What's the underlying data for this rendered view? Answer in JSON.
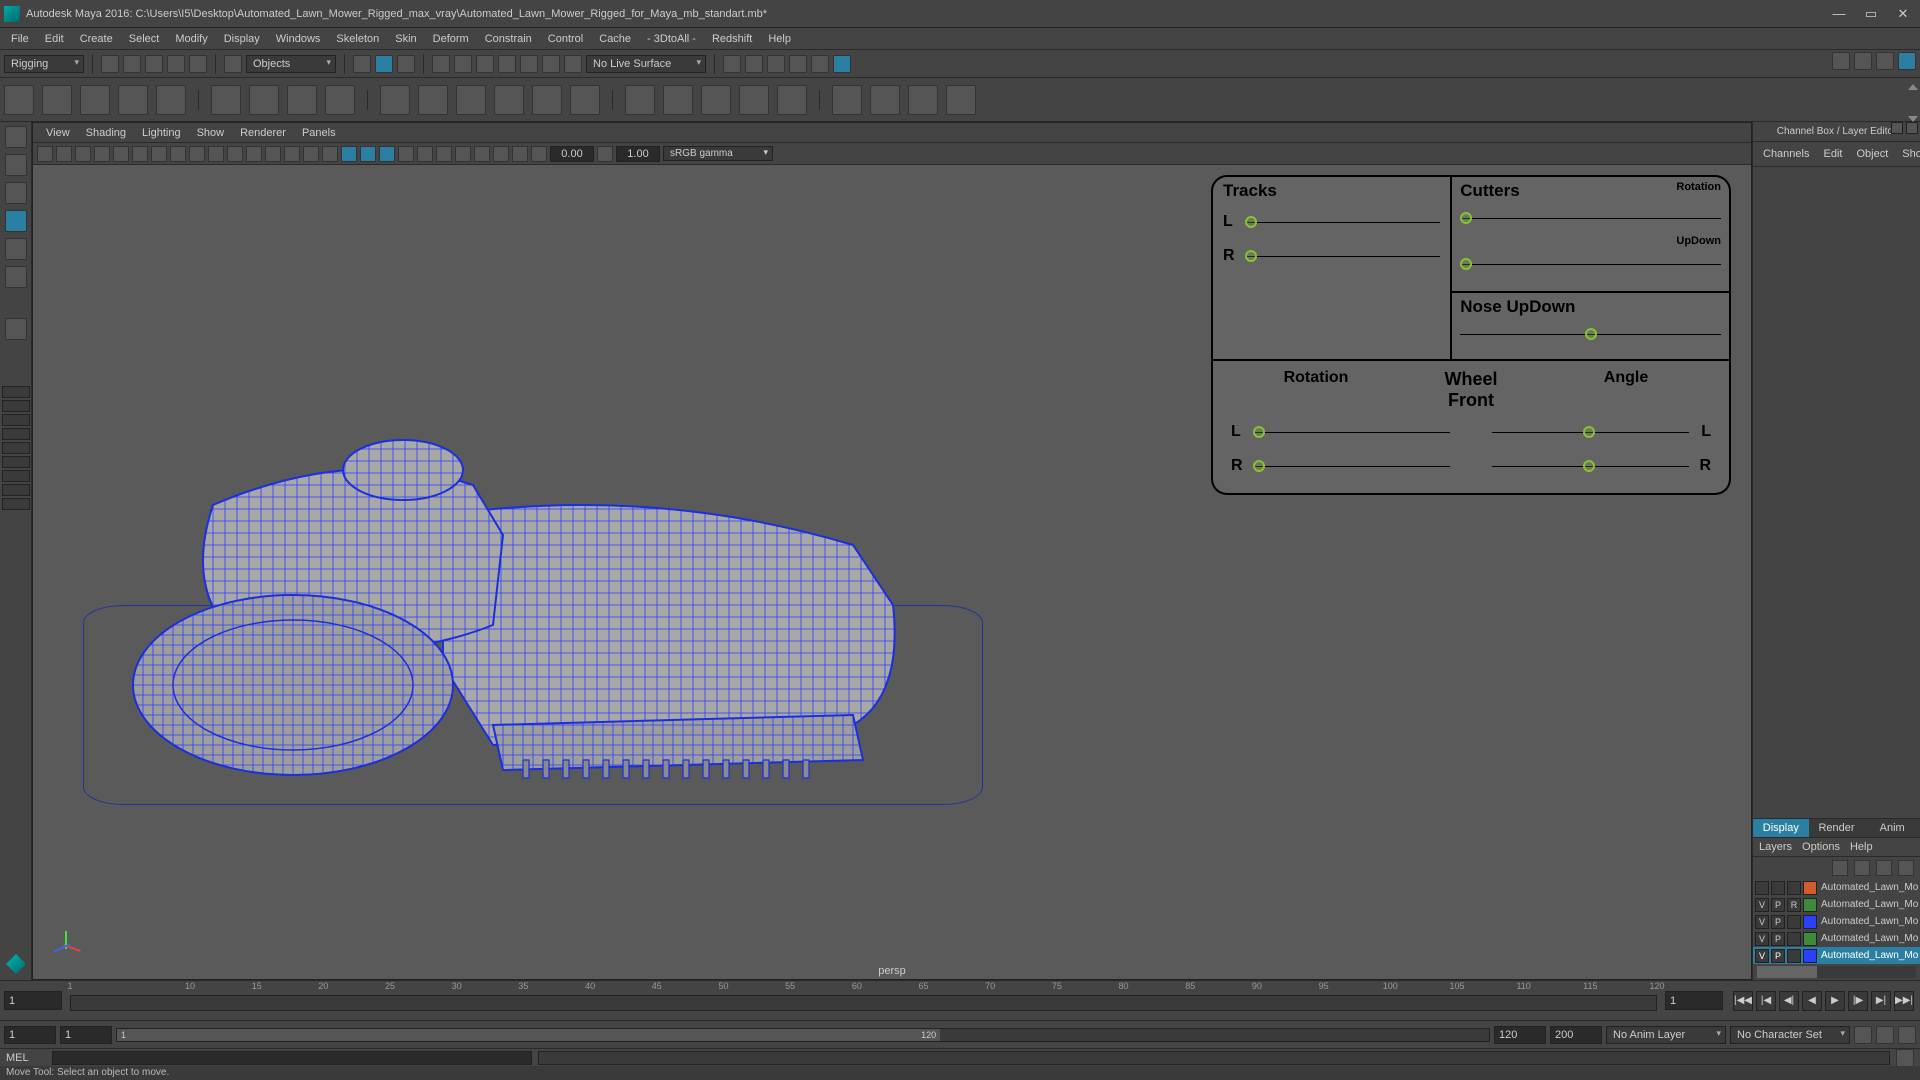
{
  "title": "Autodesk Maya 2016: C:\\Users\\I5\\Desktop\\Automated_Lawn_Mower_Rigged_max_vray\\Automated_Lawn_Mower_Rigged_for_Maya_mb_standart.mb*",
  "menubar": [
    "File",
    "Edit",
    "Create",
    "Select",
    "Modify",
    "Display",
    "Windows",
    "Skeleton",
    "Skin",
    "Deform",
    "Constrain",
    "Control",
    "Cache",
    "- 3DtoAll -",
    "Redshift",
    "Help"
  ],
  "shelf": {
    "mode": "Rigging",
    "mask_label": "Objects",
    "surface_label": "No Live Surface"
  },
  "viewport": {
    "menus": [
      "View",
      "Shading",
      "Lighting",
      "Show",
      "Renderer",
      "Panels"
    ],
    "num1": "0.00",
    "num2": "1.00",
    "colorspace": "sRGB gamma",
    "camera": "persp"
  },
  "rig_panel": {
    "tracks": "Tracks",
    "cutters": "Cutters",
    "rotation_small": "Rotation",
    "updown_small": "UpDown",
    "nose": "Nose UpDown",
    "wheel": "Wheel Front",
    "rotation": "Rotation",
    "angle": "Angle",
    "L": "L",
    "R": "R"
  },
  "rightpanel": {
    "title": "Channel Box / Layer Editor",
    "tabs": [
      "Channels",
      "Edit",
      "Object",
      "Show"
    ],
    "layer_tabs": [
      "Display",
      "Render",
      "Anim"
    ],
    "layer_menus": [
      "Layers",
      "Options",
      "Help"
    ],
    "layers": [
      {
        "v": "",
        "p": "",
        "r": "",
        "color": "#d25c2e",
        "name": "Automated_Lawn_Mov",
        "sel": false
      },
      {
        "v": "V",
        "p": "P",
        "r": "R",
        "color": "#3c8a3c",
        "name": "Automated_Lawn_Mower",
        "sel": false
      },
      {
        "v": "V",
        "p": "P",
        "r": "",
        "color": "#2b3fff",
        "name": "Automated_Lawn_Mov",
        "sel": false
      },
      {
        "v": "V",
        "p": "P",
        "r": "",
        "color": "#3c8a3c",
        "name": "Automated_Lawn_Mov",
        "sel": false
      },
      {
        "v": "V",
        "p": "P",
        "r": "",
        "color": "#2b3fff",
        "name": "Automated_Lawn_Mov",
        "sel": true
      }
    ]
  },
  "timeline": {
    "start_vis": "1",
    "end_vis": "120",
    "start_range": "1",
    "end_range": "200",
    "current": "1",
    "anim_layer": "No Anim Layer",
    "char_set": "No Character Set",
    "ticks": [
      1,
      10,
      15,
      20,
      25,
      30,
      35,
      40,
      45,
      50,
      55,
      60,
      65,
      70,
      75,
      80,
      85,
      90,
      95,
      100,
      105,
      110,
      115,
      120
    ],
    "range_thumb": "1"
  },
  "cmd": {
    "lang": "MEL"
  },
  "helpline": "Move Tool: Select an object to move."
}
